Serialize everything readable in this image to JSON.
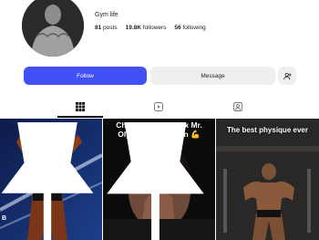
{
  "profile": {
    "username": "Gym life",
    "stats": {
      "posts": "81",
      "posts_label": "posts",
      "followers": "19.8K",
      "followers_label": "followers",
      "following": "56",
      "following_label": "following"
    }
  },
  "actions": {
    "follow_label": "Follow",
    "message_label": "Message"
  },
  "tabs": [
    {
      "icon": "grid-icon",
      "active": true
    },
    {
      "icon": "reels-icon",
      "active": false
    },
    {
      "icon": "tagged-icon",
      "active": false
    }
  ],
  "posts": [
    {
      "caption": "",
      "pinned": true,
      "watermark": "B"
    },
    {
      "caption": "Chris Bumstead: 6x Mr. Olympia Champion 💪",
      "pinned": true
    },
    {
      "caption": "The best physique ever",
      "pinned": false
    }
  ],
  "colors": {
    "accent": "#4150f7",
    "secondary_button": "#efefef"
  }
}
